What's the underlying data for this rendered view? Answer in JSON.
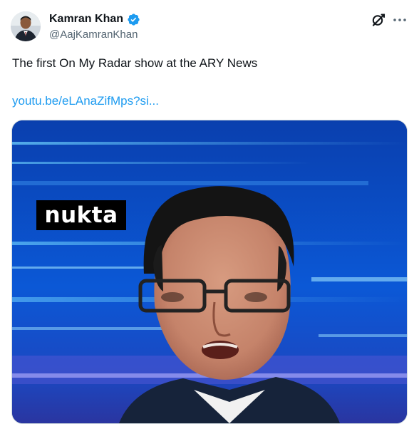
{
  "author": {
    "display_name": "Kamran Khan",
    "handle": "@AajKamranKhan",
    "verified_icon": "verified-badge-icon",
    "verified_color": "#1d9bf0"
  },
  "header_actions": {
    "grok_icon": "grok-icon",
    "more_icon": "more-icon"
  },
  "tweet": {
    "text": "The first On My Radar show at the ARY News",
    "link_text": "youtu.be/eLAnaZifMps?si..."
  },
  "media": {
    "overlay_logo_text": "nukta",
    "type": "video-thumbnail"
  },
  "colors": {
    "link": "#1d9bf0",
    "text_primary": "#0f1419",
    "text_secondary": "#536471"
  }
}
